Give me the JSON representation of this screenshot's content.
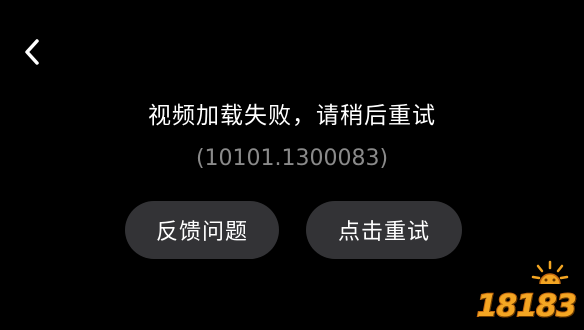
{
  "header": {
    "back_icon": "chevron-left-icon"
  },
  "error": {
    "title": "视频加载失败，请稍后重试",
    "code": "(10101.1300083)"
  },
  "actions": {
    "feedback_label": "反馈问题",
    "retry_label": "点击重试"
  },
  "watermark": {
    "text": "18183"
  },
  "colors": {
    "background": "#000000",
    "text_primary": "#ffffff",
    "text_secondary": "#8a8a8a",
    "button_bg": "#333336",
    "logo_orange": "#f4a623"
  }
}
